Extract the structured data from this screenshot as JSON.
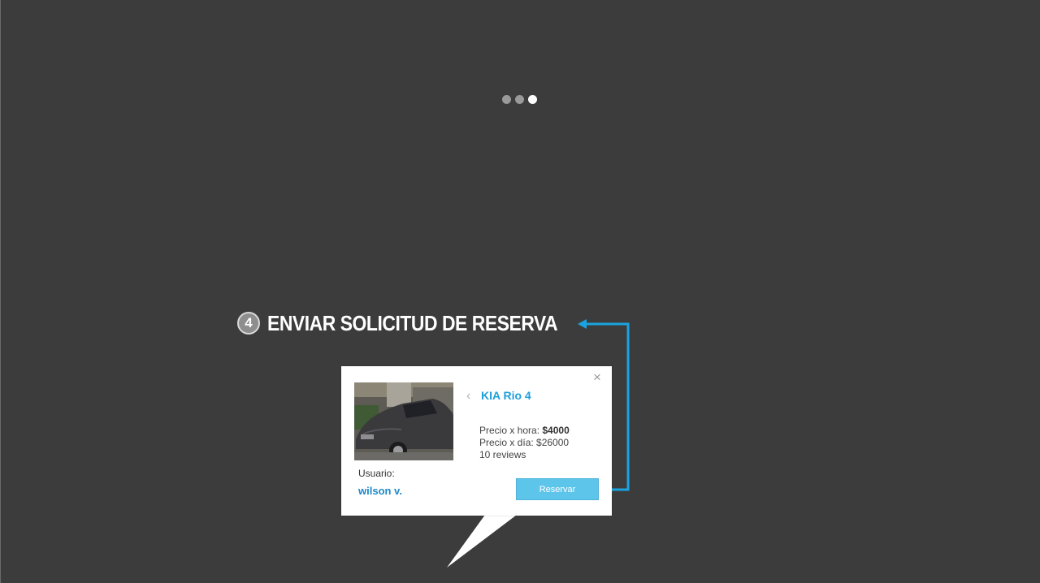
{
  "pager": {
    "count": 3,
    "active_index": 2
  },
  "step": {
    "number": "4",
    "title": "ENVIAR SOLICITUD DE RESERVA"
  },
  "card": {
    "close_icon": "×",
    "back_icon": "‹",
    "car_name": "KIA Rio 4",
    "price_hour_label": "Precio x hora: ",
    "price_hour_value": "$4000",
    "price_day": "Precio x día: $26000",
    "reviews": "10 reviews",
    "user_label": "Usuario:",
    "user_name": "wilson v.",
    "reserve_label": "Reservar"
  },
  "colors": {
    "background": "#3c3c3c",
    "accent": "#1e9fdb",
    "connector": "#1aa3e0",
    "button": "#5ec5ea"
  },
  "icons": {
    "close": "close-icon",
    "back": "chevron-left-icon",
    "step_badge": "number-badge-icon"
  }
}
